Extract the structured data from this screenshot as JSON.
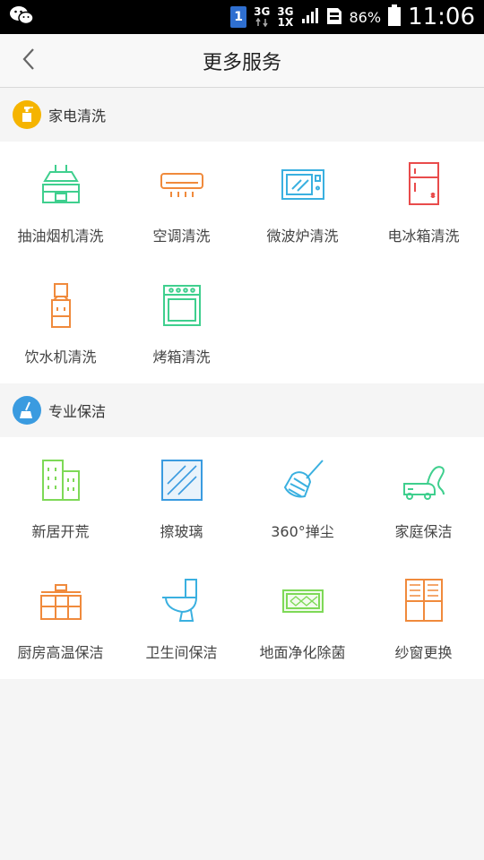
{
  "status_bar": {
    "sim": "1",
    "net1_top": "3G",
    "net2_top": "3G",
    "net2_bottom": "1X",
    "battery": "86%",
    "time": "11:06"
  },
  "header": {
    "title": "更多服务"
  },
  "sections": [
    {
      "title": "家电清洗",
      "icon": "spray-bottle-icon",
      "color": "#f5b400",
      "items": [
        {
          "label": "抽油烟机清洗",
          "icon": "range-hood-icon",
          "color": "#3fcf8e"
        },
        {
          "label": "空调清洗",
          "icon": "air-conditioner-icon",
          "color": "#f08a3c"
        },
        {
          "label": "微波炉清洗",
          "icon": "microwave-icon",
          "color": "#3ab0e0"
        },
        {
          "label": "电冰箱清洗",
          "icon": "refrigerator-icon",
          "color": "#e94b4b"
        },
        {
          "label": "饮水机清洗",
          "icon": "water-dispenser-icon",
          "color": "#f08a3c"
        },
        {
          "label": "烤箱清洗",
          "icon": "oven-icon",
          "color": "#3fcf8e"
        }
      ]
    },
    {
      "title": "专业保洁",
      "icon": "broom-icon",
      "color": "#3a9be0",
      "items": [
        {
          "label": "新居开荒",
          "icon": "building-icon",
          "color": "#7ed957"
        },
        {
          "label": "擦玻璃",
          "icon": "glass-pane-icon",
          "color": "#3a9be0"
        },
        {
          "label": "360°掸尘",
          "icon": "duster-icon",
          "color": "#3ab0e0"
        },
        {
          "label": "家庭保洁",
          "icon": "vacuum-icon",
          "color": "#3fcf8e"
        },
        {
          "label": "厨房高温保洁",
          "icon": "kitchen-cabinet-icon",
          "color": "#f08a3c"
        },
        {
          "label": "卫生间保洁",
          "icon": "toilet-icon",
          "color": "#3ab0e0"
        },
        {
          "label": "地面净化除菌",
          "icon": "floor-mat-icon",
          "color": "#7ed957"
        },
        {
          "label": "纱窗更换",
          "icon": "window-screen-icon",
          "color": "#f08a3c"
        }
      ]
    }
  ]
}
